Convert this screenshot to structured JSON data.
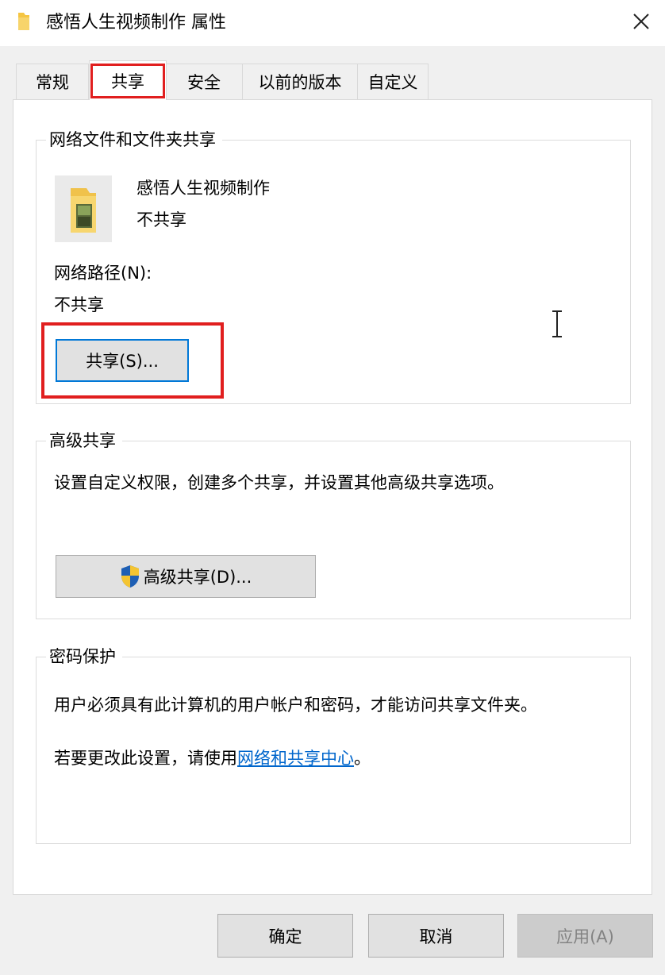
{
  "window": {
    "title": "感悟人生视频制作 属性"
  },
  "tabs": [
    {
      "label": "常规"
    },
    {
      "label": "共享"
    },
    {
      "label": "安全"
    },
    {
      "label": "以前的版本"
    },
    {
      "label": "自定义"
    }
  ],
  "network_sharing": {
    "title": "网络文件和文件夹共享",
    "folder_name": "感悟人生视频制作",
    "status": "不共享",
    "path_label": "网络路径(N):",
    "path_value": "不共享",
    "share_button": "共享(S)..."
  },
  "advanced_sharing": {
    "title": "高级共享",
    "description": "设置自定义权限，创建多个共享，并设置其他高级共享选项。",
    "button": "高级共享(D)..."
  },
  "password_protection": {
    "title": "密码保护",
    "description": "用户必须具有此计算机的用户帐户和密码，才能访问共享文件夹。",
    "change_prefix": "若要更改此设置，请使用",
    "link": "网络和共享中心",
    "change_suffix": "。"
  },
  "footer": {
    "ok": "确定",
    "cancel": "取消",
    "apply": "应用(A)"
  },
  "colors": {
    "highlight": "#e11f1f",
    "link": "#0066cc",
    "focus_border": "#0078d7",
    "folder": "#f5c542"
  }
}
